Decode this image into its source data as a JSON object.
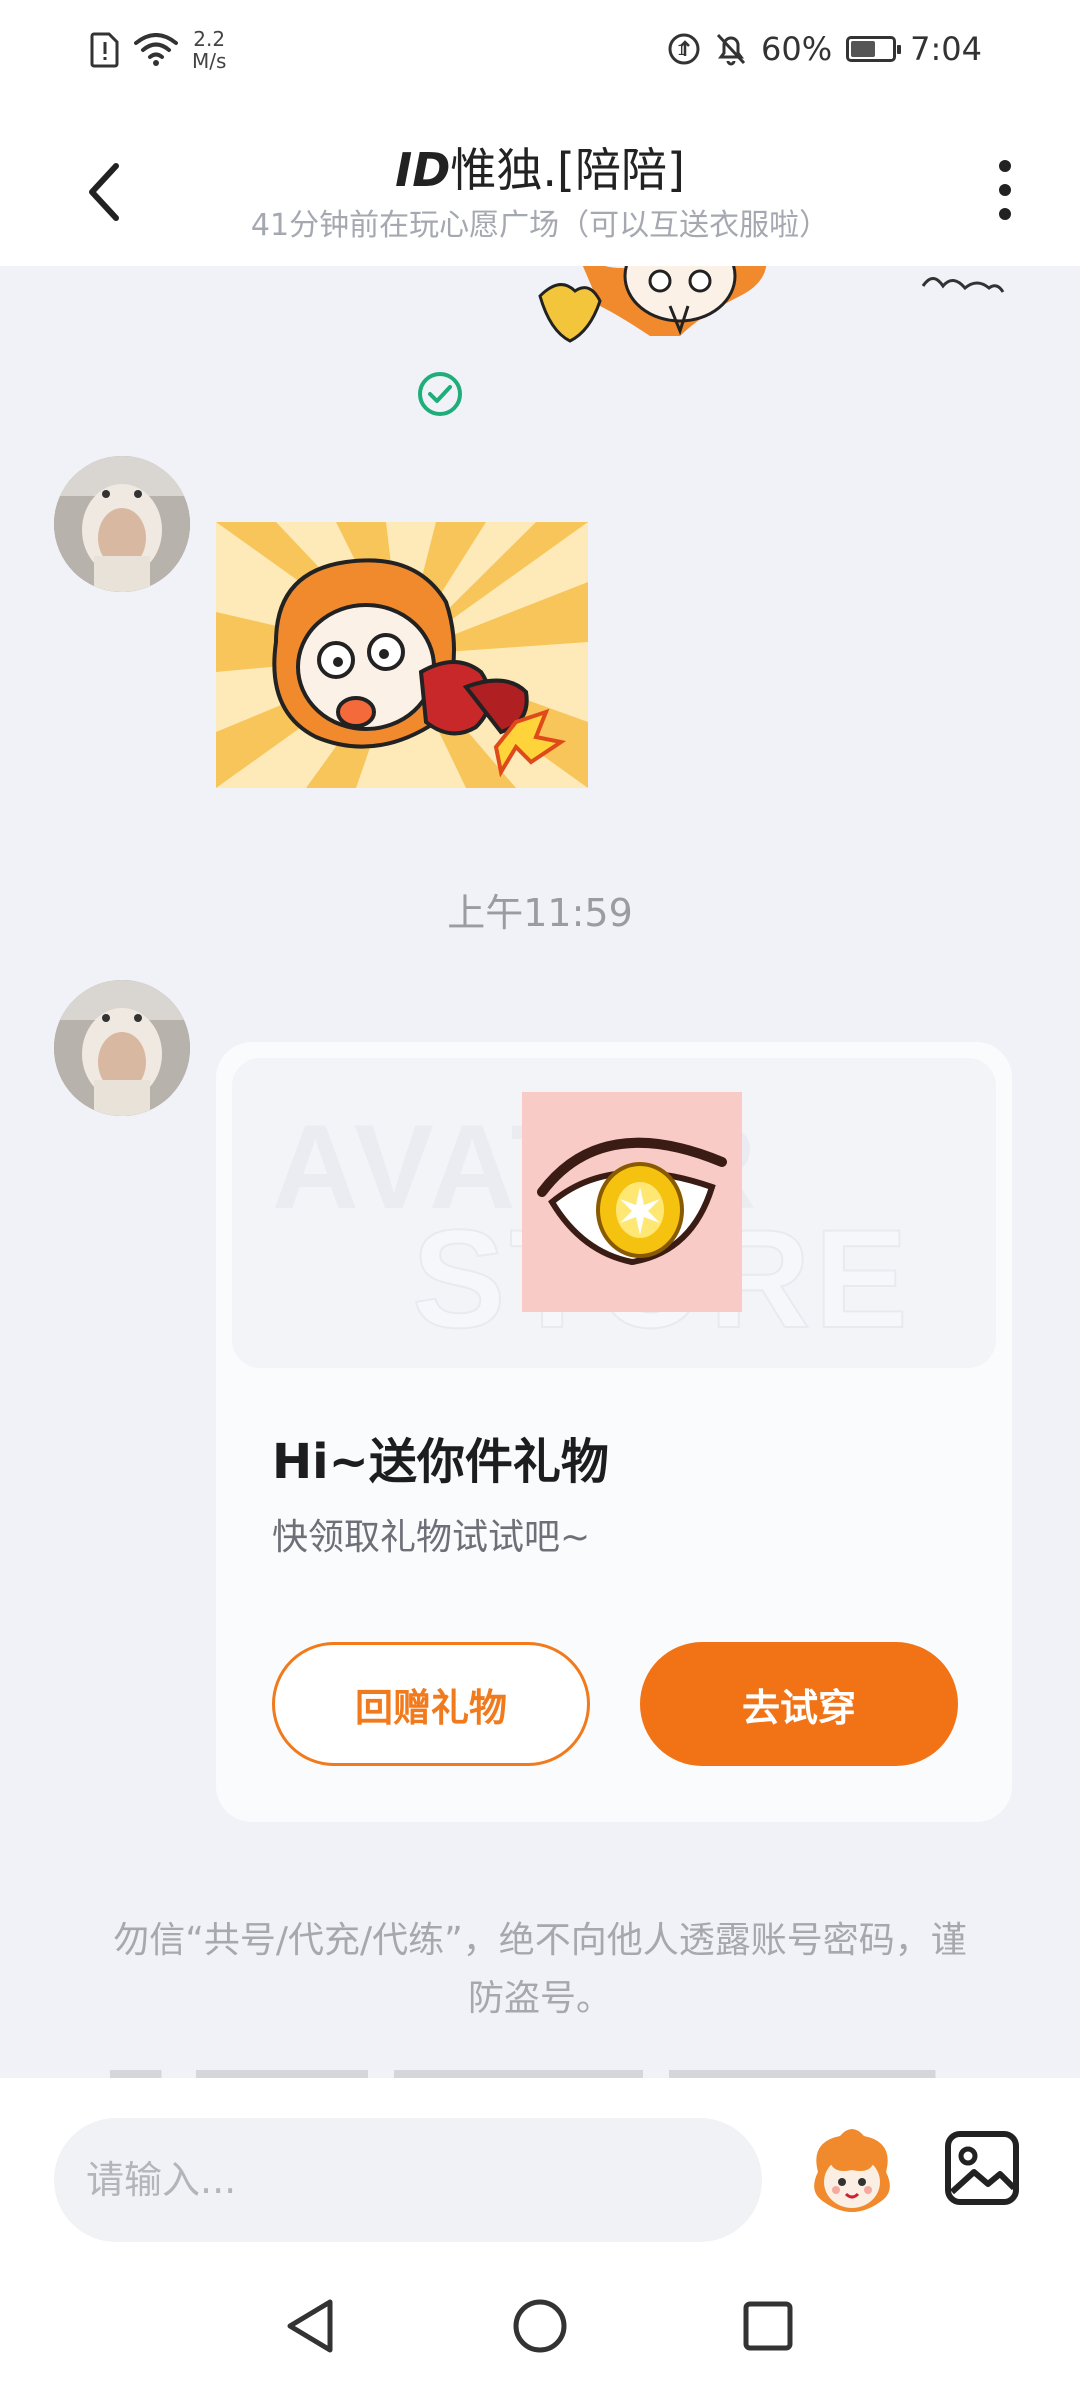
{
  "status_bar": {
    "network_speed_value": "2.2",
    "network_speed_unit": "M/s",
    "battery_percent": "60%",
    "time": "7:04",
    "battery_level": 0.6
  },
  "header": {
    "title_id": "ID",
    "title_name": "惟独.[陪陪]",
    "subtitle": "41分钟前在玩心愿广场（可以互送衣服啦）"
  },
  "chat": {
    "timestamp": "上午11:59",
    "gift_card": {
      "watermark_line1": "AVATAR",
      "watermark_line2": "STORE",
      "title": "Hi~送你件礼物",
      "subtitle": "快领取礼物试试吧~",
      "return_gift_label": "回赠礼物",
      "try_on_label": "去试穿"
    },
    "warning": "勿信“共号/代充/代练”，绝不向他人透露账号密码，谨防盗号。"
  },
  "input_bar": {
    "placeholder": "请输入..."
  },
  "colors": {
    "accent": "#f27315",
    "check_green": "#1fae7a"
  }
}
